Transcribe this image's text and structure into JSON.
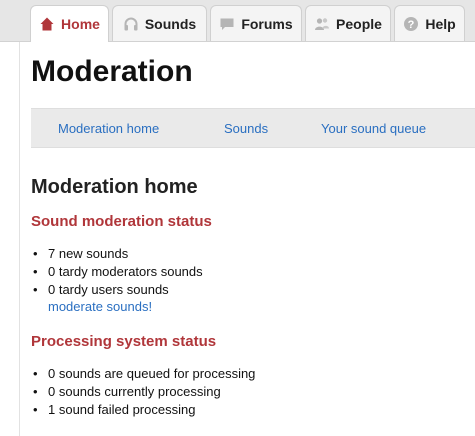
{
  "nav": {
    "tabs": [
      {
        "label": "Home",
        "icon": "home-icon",
        "active": true
      },
      {
        "label": "Sounds",
        "icon": "headphones-icon",
        "active": false
      },
      {
        "label": "Forums",
        "icon": "chat-icon",
        "active": false
      },
      {
        "label": "People",
        "icon": "people-icon",
        "active": false
      },
      {
        "label": "Help",
        "icon": "help-icon",
        "active": false
      }
    ]
  },
  "page": {
    "title": "Moderation"
  },
  "subnav": {
    "items": [
      "Moderation home",
      "Sounds",
      "Your sound queue"
    ]
  },
  "main": {
    "heading": "Moderation home",
    "sound_status": {
      "title": "Sound moderation status",
      "items": [
        "7 new sounds",
        "0 tardy moderators sounds",
        "0 tardy users sounds"
      ],
      "link": "moderate sounds!"
    },
    "processing_status": {
      "title": "Processing system status",
      "items": [
        "0 sounds are queued for processing",
        "0 sounds currently processing",
        "1 sound failed processing"
      ]
    }
  },
  "colors": {
    "accent": "#b0363a",
    "link": "#2a6fc1",
    "tab_bar": "#e6e6e6",
    "subnav_bg": "#eaeaea"
  }
}
